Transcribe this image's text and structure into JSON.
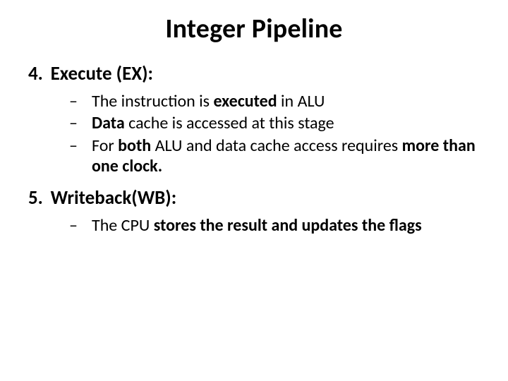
{
  "title": "Integer Pipeline",
  "items": [
    {
      "num": "4.",
      "headline": "Execute (EX):",
      "bullets": [
        {
          "pre": "The instruction is ",
          "bold": "executed",
          "post": " in ALU"
        },
        {
          "pre": "",
          "bold": "Data",
          "post": " cache is accessed at this stage"
        },
        {
          "pre": "For ",
          "bold": "both",
          "post": " ALU and data cache access requires ",
          "bold2": "more than one clock."
        }
      ]
    },
    {
      "num": "5.",
      "headline": "Writeback(WB):",
      "bullets": [
        {
          "pre": "The CPU ",
          "bold": "stores the result and updates the flags",
          "post": ""
        }
      ]
    }
  ]
}
